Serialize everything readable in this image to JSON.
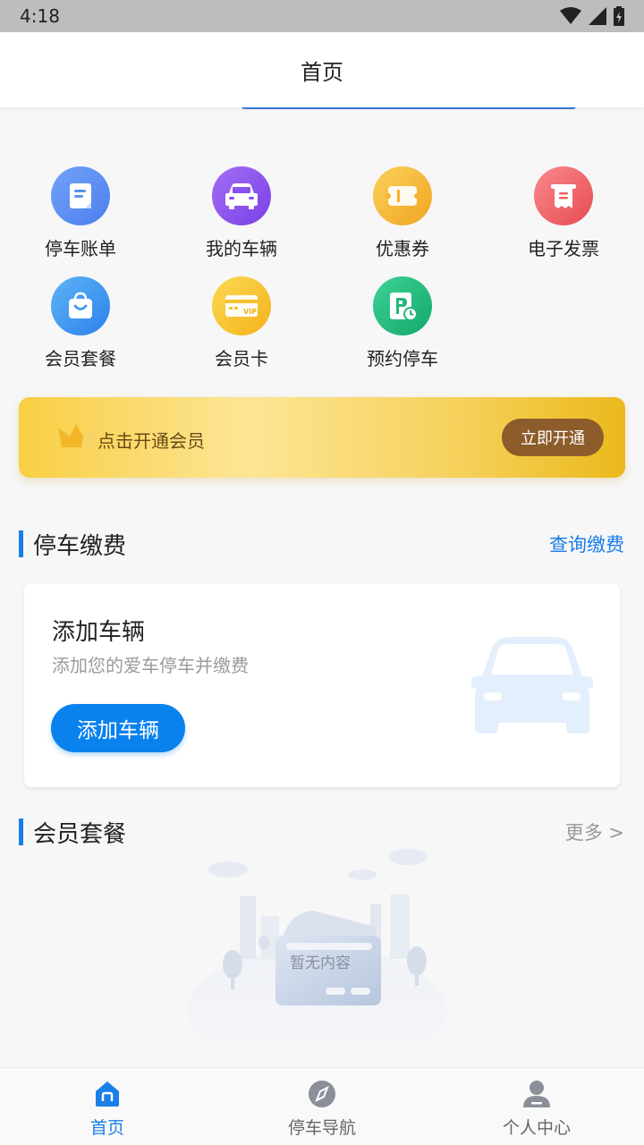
{
  "status_bar": {
    "time": "4:18"
  },
  "header": {
    "title": "首页"
  },
  "quick_grid": {
    "row1": [
      {
        "label": "停车账单",
        "icon": "bill-icon",
        "color": "#5b8ff2"
      },
      {
        "label": "我的车辆",
        "icon": "car-icon",
        "color": "#8a52ee"
      },
      {
        "label": "优惠券",
        "icon": "coupon-icon",
        "color": "#f5b32f"
      },
      {
        "label": "电子发票",
        "icon": "invoice-icon",
        "color": "#ef6166"
      }
    ],
    "row2": [
      {
        "label": "会员套餐",
        "icon": "shopping-bag-icon",
        "color": "#3c97f0"
      },
      {
        "label": "会员卡",
        "icon": "vip-card-icon",
        "color": "#f7c22a"
      },
      {
        "label": "预约停车",
        "icon": "parking-reserve-icon",
        "color": "#21b77a"
      }
    ]
  },
  "member_banner": {
    "text": "点击开通会员",
    "button": "立即开通"
  },
  "parking_section": {
    "title": "停车缴费",
    "link": "查询缴费",
    "link_color": "#1a7fe6"
  },
  "vehicle_card": {
    "title": "添加车辆",
    "subtitle": "添加您的爱车停车并缴费",
    "button": "添加车辆"
  },
  "package_section": {
    "title": "会员套餐",
    "link": "更多 >",
    "link_color": "#999999"
  },
  "empty_state": {
    "text": "暂无内容"
  },
  "bottom_nav": [
    {
      "label": "首页",
      "icon": "home-icon",
      "active": true
    },
    {
      "label": "停车导航",
      "icon": "compass-icon",
      "active": false
    },
    {
      "label": "个人中心",
      "icon": "user-icon",
      "active": false
    }
  ],
  "colors": {
    "accent": "#1a7fe6",
    "member_button": "#8d5c2b",
    "primary_button": "#0a82ee"
  }
}
